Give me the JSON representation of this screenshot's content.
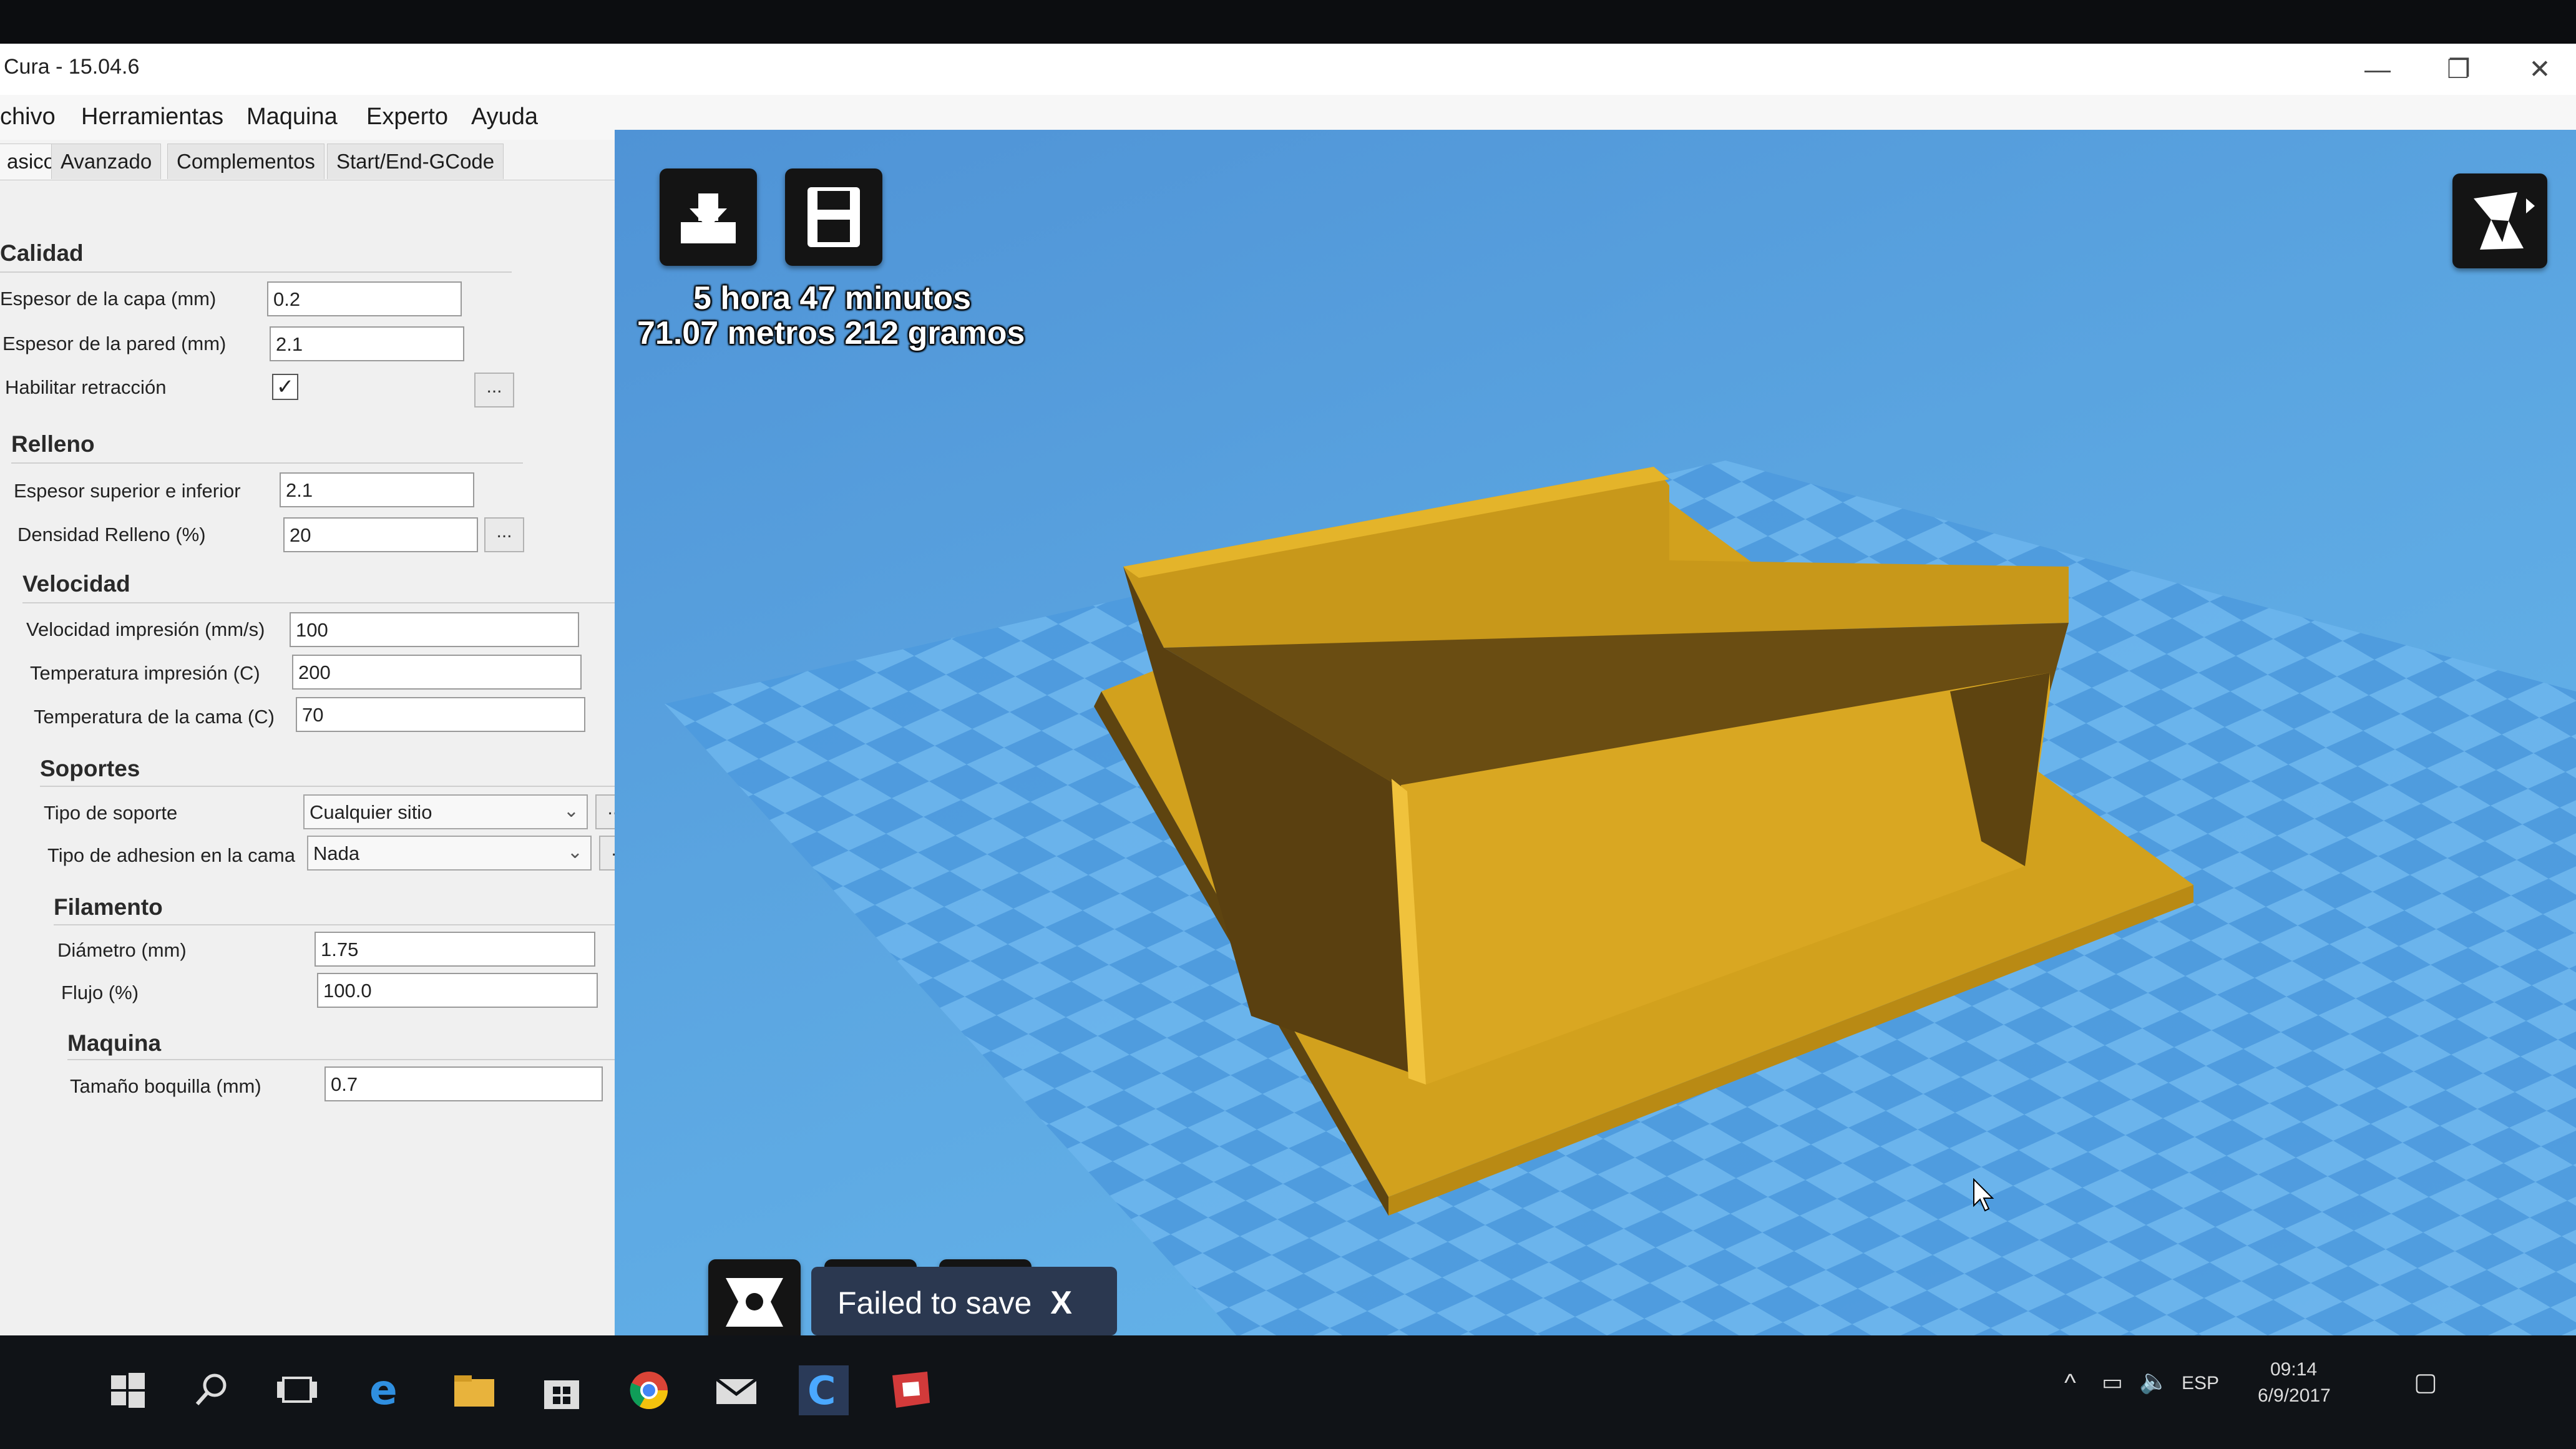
{
  "window": {
    "title": "Cura - 15.04.6",
    "minimize_glyph": "—",
    "maximize_glyph": "❐",
    "close_glyph": "✕"
  },
  "menu": [
    "chivo",
    "Herramientas",
    "Maquina",
    "Experto",
    "Ayuda"
  ],
  "tabs": [
    "asico",
    "Avanzado",
    "Complementos",
    "Start/End-GCode"
  ],
  "sections": {
    "calidad": {
      "title": "Calidad",
      "layer_height_label": "Espesor de la capa (mm)",
      "layer_height": "0.2",
      "wall_label": "Espesor de la pared (mm)",
      "wall": "2.1",
      "retraction_label": "Habilitar retracción",
      "retraction_checked": true
    },
    "relleno": {
      "title": "Relleno",
      "topbottom_label": "Espesor superior e inferior",
      "topbottom": "2.1",
      "density_label": "Densidad Relleno (%)",
      "density": "20"
    },
    "velocidad": {
      "title": "Velocidad",
      "speed_label": "Velocidad impresión (mm/s)",
      "speed": "100",
      "temp_label": "Temperatura impresión (C)",
      "temp": "200",
      "bed_label": "Temperatura de la cama (C)",
      "bed": "70"
    },
    "soportes": {
      "title": "Soportes",
      "support_label": "Tipo de soporte",
      "support": "Cualquier sitio",
      "adhesion_label": "Tipo de adhesion en la cama",
      "adhesion": "Nada"
    },
    "filamento": {
      "title": "Filamento",
      "diameter_label": "Diámetro (mm)",
      "diameter": "1.75",
      "flow_label": "Flujo (%)",
      "flow": "100.0"
    },
    "maquina": {
      "title": "Maquina",
      "nozzle_label": "Tamaño boquilla (mm)",
      "nozzle": "0.7"
    }
  },
  "more_button": "...",
  "print_info": {
    "time": "5 hora 47 minutos",
    "material": "71.07 metros 212 gramos"
  },
  "toast": {
    "message": "Failed to save",
    "close": "X"
  },
  "tray": {
    "lang": "ESP",
    "time": "09:14",
    "date": "6/9/2017"
  },
  "colors": {
    "model_light": "#d4a320",
    "model_dark": "#5e4410",
    "build_plate": "#5aa4e0",
    "toast_bg": "#2b3850"
  }
}
